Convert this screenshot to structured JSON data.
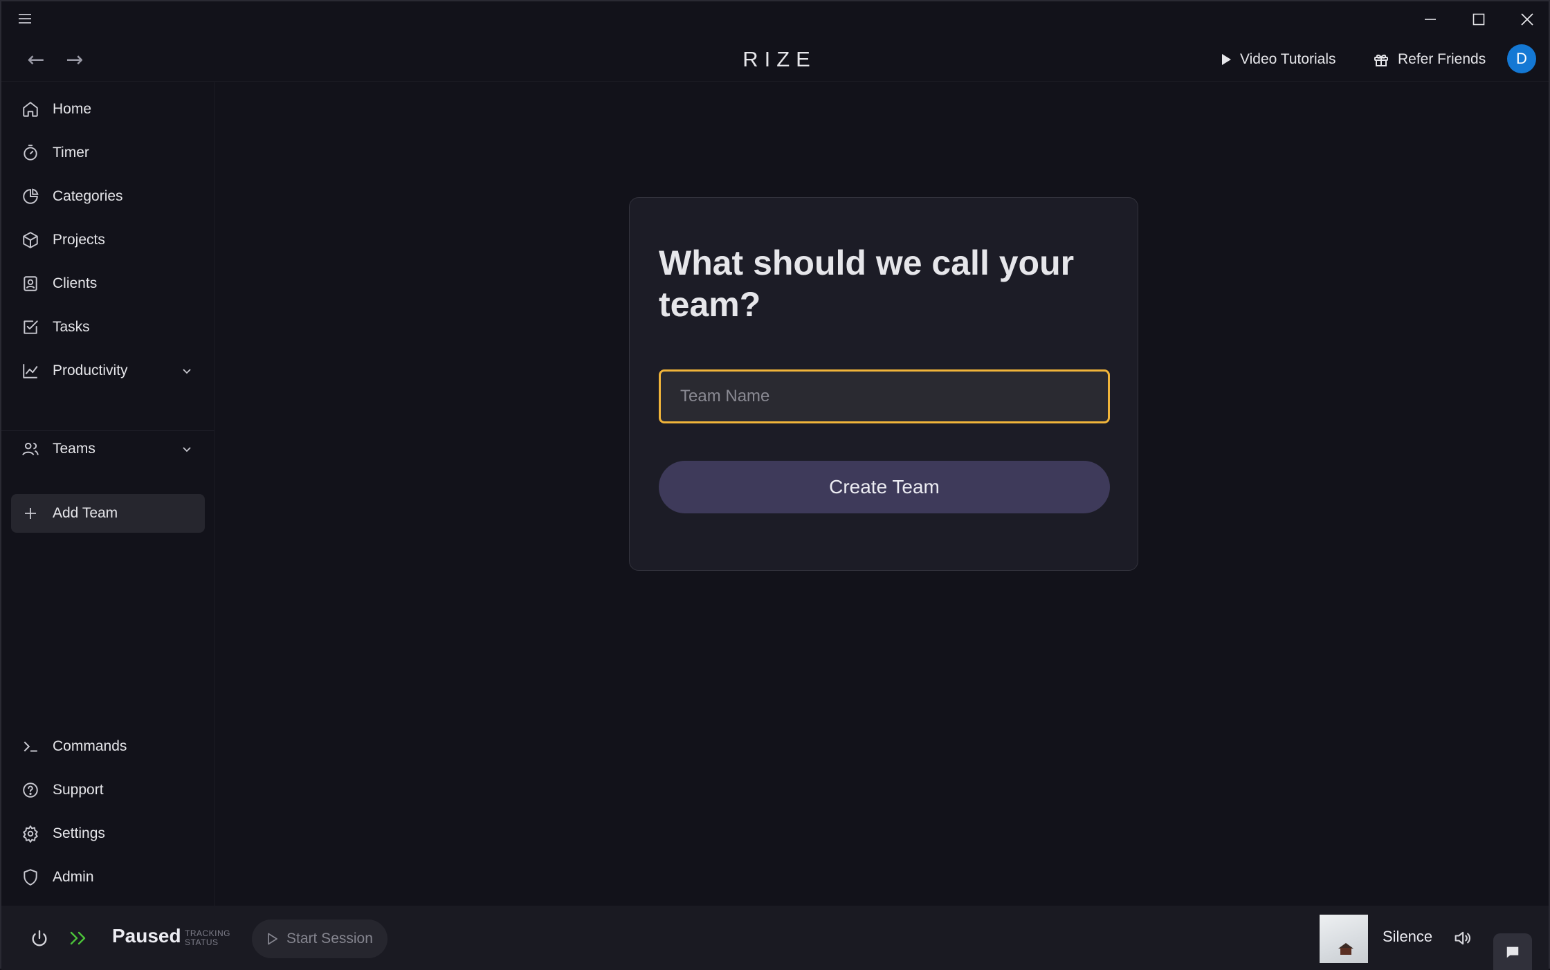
{
  "window": {
    "menu_icon": "hamburger-icon",
    "controls": [
      "minimize-icon",
      "maximize-icon",
      "close-icon"
    ]
  },
  "header": {
    "logo": "RIZE",
    "back_icon": "←",
    "forward_icon": "→",
    "video_tutorials": "Video Tutorials",
    "refer_friends": "Refer Friends",
    "avatar_initial": "D",
    "avatar_color": "#1478d4"
  },
  "sidebar": {
    "items": [
      {
        "label": "Home",
        "icon": "home-icon"
      },
      {
        "label": "Timer",
        "icon": "timer-icon"
      },
      {
        "label": "Categories",
        "icon": "pie-chart-icon"
      },
      {
        "label": "Projects",
        "icon": "cube-icon"
      },
      {
        "label": "Clients",
        "icon": "contact-icon"
      },
      {
        "label": "Tasks",
        "icon": "checkbox-icon"
      },
      {
        "label": "Productivity",
        "icon": "line-chart-icon",
        "expandable": true
      }
    ],
    "teams": {
      "label": "Teams",
      "icon": "users-icon",
      "expandable": true
    },
    "add_team": {
      "label": "Add Team",
      "icon": "plus-icon",
      "active": true
    },
    "bottom_items": [
      {
        "label": "Commands",
        "icon": "terminal-icon"
      },
      {
        "label": "Support",
        "icon": "help-circle-icon"
      },
      {
        "label": "Settings",
        "icon": "gear-icon"
      },
      {
        "label": "Admin",
        "icon": "shield-icon"
      }
    ]
  },
  "main": {
    "card_title": "What should we call your team?",
    "team_name_input": {
      "placeholder": "Team Name",
      "value": ""
    },
    "create_button": "Create Team",
    "accent_color": "#f0b43a"
  },
  "bottom_bar": {
    "status": "Paused",
    "status_label_line1": "TRACKING",
    "status_label_line2": "STATUS",
    "start_session": "Start Session",
    "music_name": "Silence",
    "skip_color": "#4cc43a"
  }
}
